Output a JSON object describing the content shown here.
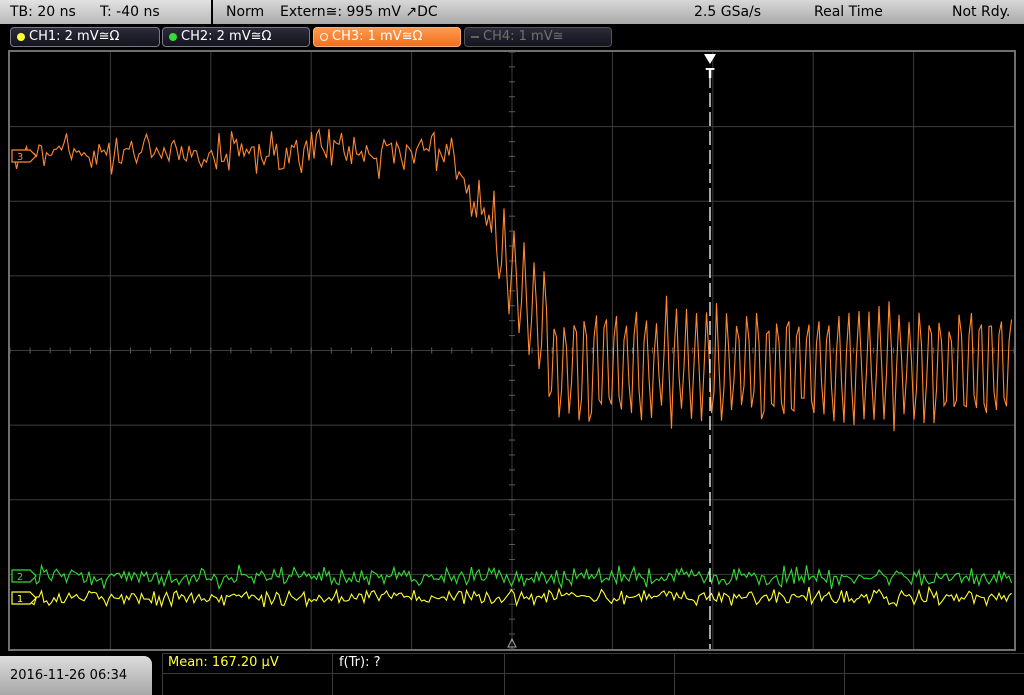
{
  "status_bar": {
    "timebase": "TB: 20 ns",
    "trigger_time": "T: -40 ns",
    "mode": "Norm",
    "trigger_source": "Extern≅: 995 mV ↗DC",
    "sample_rate": "2.5 GSa/s",
    "acq_mode": "Real Time",
    "state": "Not Rdy."
  },
  "channels": [
    {
      "label": "CH1: 2 mV≅Ω",
      "color": "#ffff33",
      "state": "on"
    },
    {
      "label": "CH2: 2 mV≅Ω",
      "color": "#33dd33",
      "state": "on"
    },
    {
      "label": "CH3: 1 mV≅Ω",
      "color": "#ff8833",
      "state": "selected"
    },
    {
      "label": "CH4: 1 mV≅",
      "color": "#707070",
      "state": "off"
    }
  ],
  "screen": {
    "trigger_marker": "T",
    "ch3_marker": "3",
    "ch2_marker": "2",
    "ch1_marker": "1"
  },
  "footer": {
    "datetime": "2016-11-26 06:34",
    "measure_mean": "Mean: 167.20 µV",
    "measure_ftr": "f(Tr): ?"
  },
  "colors": {
    "ch1": "#ffff33",
    "ch2": "#33dd33",
    "ch3": "#ff8833",
    "grid": "#3d3d3d",
    "trigger": "#ffffff"
  }
}
